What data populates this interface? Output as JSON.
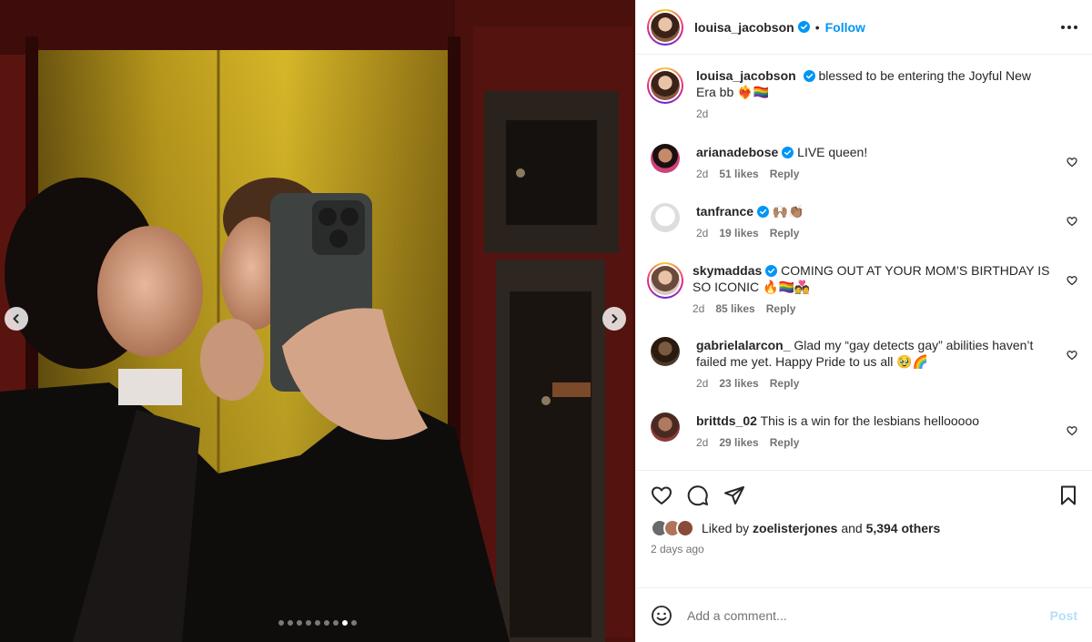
{
  "header": {
    "username": "louisa_jacobson",
    "follow_label": "Follow",
    "bullet": "•"
  },
  "caption": {
    "username": "louisa_jacobson",
    "text": "blessed to be entering the Joyful New Era bb ❤️‍🔥🏳️‍🌈",
    "time": "2d"
  },
  "comments": [
    {
      "username": "arianadebose",
      "verified": true,
      "text": "LIVE queen!",
      "time": "2d",
      "likes": "51 likes",
      "reply": "Reply"
    },
    {
      "username": "tanfrance",
      "verified": true,
      "text": "🙌🏽👏🏽",
      "time": "2d",
      "likes": "19 likes",
      "reply": "Reply"
    },
    {
      "username": "skymaddas",
      "verified": true,
      "text": "COMING OUT AT YOUR MOM’S BIRTHDAY IS SO ICONIC 🔥🏳️‍🌈💑",
      "time": "2d",
      "likes": "85 likes",
      "reply": "Reply"
    },
    {
      "username": "gabrielalarcon_",
      "verified": false,
      "text": "Glad my “gay detects gay” abilities haven’t failed me yet. Happy Pride to us all 🥹🌈",
      "time": "2d",
      "likes": "23 likes",
      "reply": "Reply"
    },
    {
      "username": "brittds_02",
      "verified": false,
      "text": "This is a win for the lesbians hellooooo",
      "time": "2d",
      "likes": "29 likes",
      "reply": "Reply"
    }
  ],
  "likes": {
    "prefix": "Liked by",
    "user": "zoelisterjones",
    "middle": "and",
    "others": "5,394 others"
  },
  "time_ago": "2 days ago",
  "add_comment": {
    "placeholder": "Add a comment...",
    "post_label": "Post"
  },
  "carousel": {
    "count": 9,
    "active_index": 7
  },
  "colors": {
    "accent": "#0095f6",
    "post_disabled": "#b2dffc",
    "verified": "#0095f6"
  },
  "icons": [
    "chevron-left-icon",
    "chevron-right-icon",
    "more-icon",
    "verified-icon",
    "heart-icon",
    "comment-icon",
    "share-icon",
    "bookmark-icon",
    "emoji-icon"
  ]
}
